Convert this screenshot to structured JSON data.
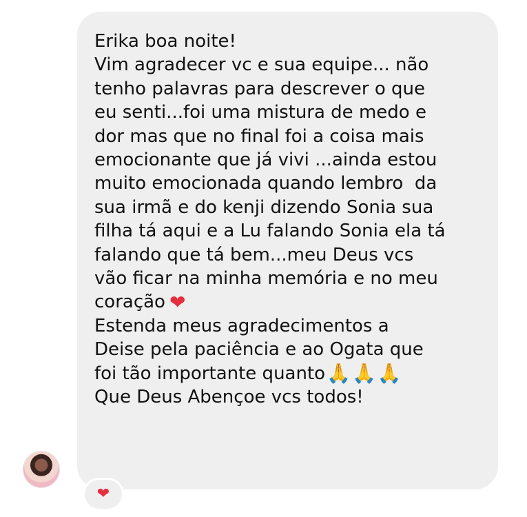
{
  "message": {
    "lines": [
      "Erika boa noite!",
      "Vim agradecer vc e sua equipe... não",
      "tenho palavras para descrever o que",
      "eu senti...foi uma mistura de medo e",
      "dor mas que no final foi a coisa mais",
      "emocionante que já vivi ...ainda estou",
      "muito emocionada quando lembro  da",
      "sua irmã e do kenji dizendo Sonia sua",
      "filha tá aqui e a Lu falando Sonia ela tá",
      "falando que tá bem...meu Deus vcs",
      "vão ficar na minha memória e no meu",
      "coração",
      "Estenda meus agradecimentos a",
      "Deise pela paciência e ao Ogata que",
      "foi tão importante quanto",
      "Que Deus Abençoe vcs todos!"
    ],
    "emojis": {
      "heart": "❤",
      "pray": "🙏"
    }
  },
  "reaction": {
    "emoji": "❤"
  },
  "icons": {
    "heart_color": "#e62e3e",
    "bubble_color": "#efefef"
  }
}
